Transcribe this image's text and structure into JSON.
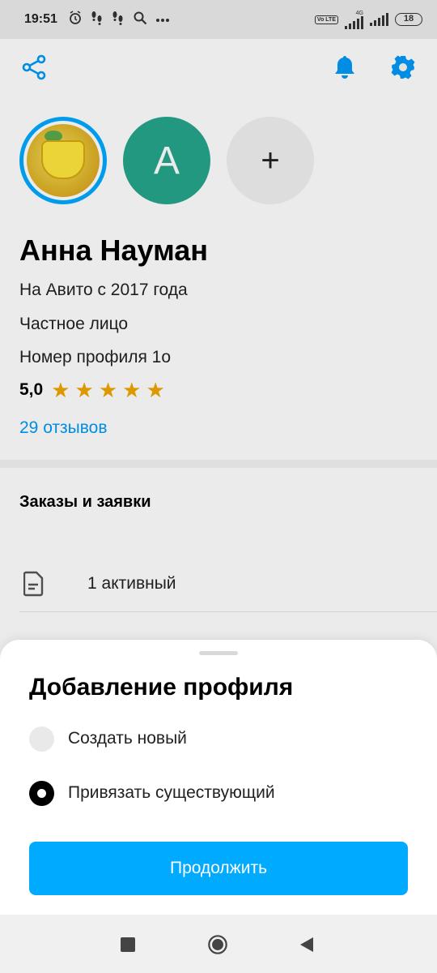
{
  "status_bar": {
    "time": "19:51",
    "network_label": "4G",
    "volte_label": "Vo LTE",
    "battery": "18"
  },
  "top_bar": {
    "share_icon": "share-icon",
    "bell_icon": "bell-icon",
    "settings_icon": "gear-icon"
  },
  "avatars": {
    "second_letter": "A",
    "add_symbol": "+"
  },
  "profile": {
    "name": "Анна Науман",
    "since": "На Авито с 2017 года",
    "type": "Частное лицо",
    "profile_number": "Номер профиля 1о",
    "rating": "5,0",
    "stars": 5,
    "reviews_link": "29 отзывов"
  },
  "orders": {
    "section_title": "Заказы и заявки",
    "active_label": "1 активный"
  },
  "sheet": {
    "title": "Добавление профиля",
    "option_new": "Создать новый",
    "option_link": "Привязать существующий",
    "selected": "option_link",
    "continue_label": "Продолжить"
  },
  "colors": {
    "accent": "#00aaff",
    "link": "#0099f7",
    "star": "#f0a500",
    "avatar_letter_bg": "#26a58c"
  }
}
